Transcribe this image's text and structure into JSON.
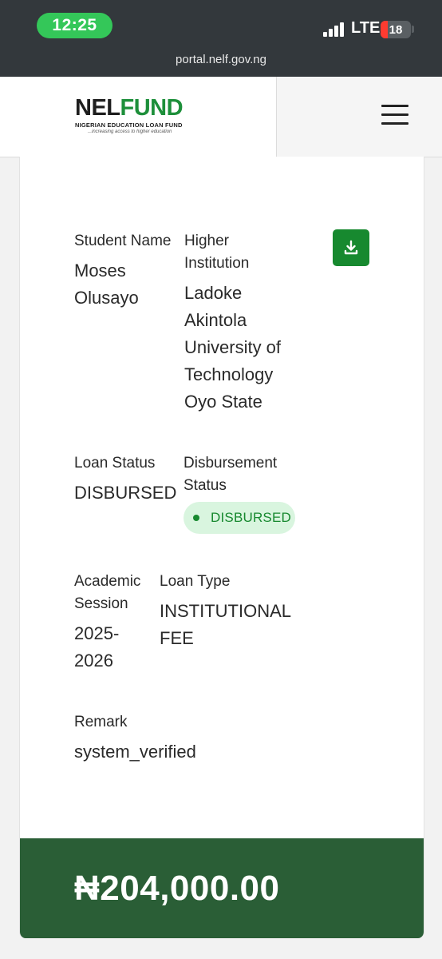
{
  "status_bar": {
    "time": "12:25",
    "network": "LTE",
    "battery": "18",
    "url": "portal.nelf.gov.ng"
  },
  "header": {
    "logo_part1": "NEL",
    "logo_part2": "FUND",
    "logo_subtitle": "NIGERIAN EDUCATION LOAN FUND",
    "logo_tagline": "...increasing access to higher education",
    "menu_icon": "hamburger-menu-icon"
  },
  "loan": {
    "student_name_label": "Student Name",
    "student_name": "Moses Olusayo",
    "institution_label": "Higher Institution",
    "institution": "Ladoke Akintola University of Technology Oyo State",
    "loan_status_label": "Loan Status",
    "loan_status": "DISBURSED",
    "disbursement_status_label": "Disbursement Status",
    "disbursement_status": "DISBURSED",
    "session_label": "Academic Session",
    "session": "2025-2026",
    "loan_type_label": "Loan Type",
    "loan_type": "INSTITUTIONAL FEE",
    "remark_label": "Remark",
    "remark": "system_verified",
    "amount": "₦204,000.00"
  },
  "colors": {
    "brand_green": "#17892f",
    "amount_bar": "#2a5e36",
    "badge_bg": "#d9f5df",
    "status_bar_bg": "#33383c"
  }
}
